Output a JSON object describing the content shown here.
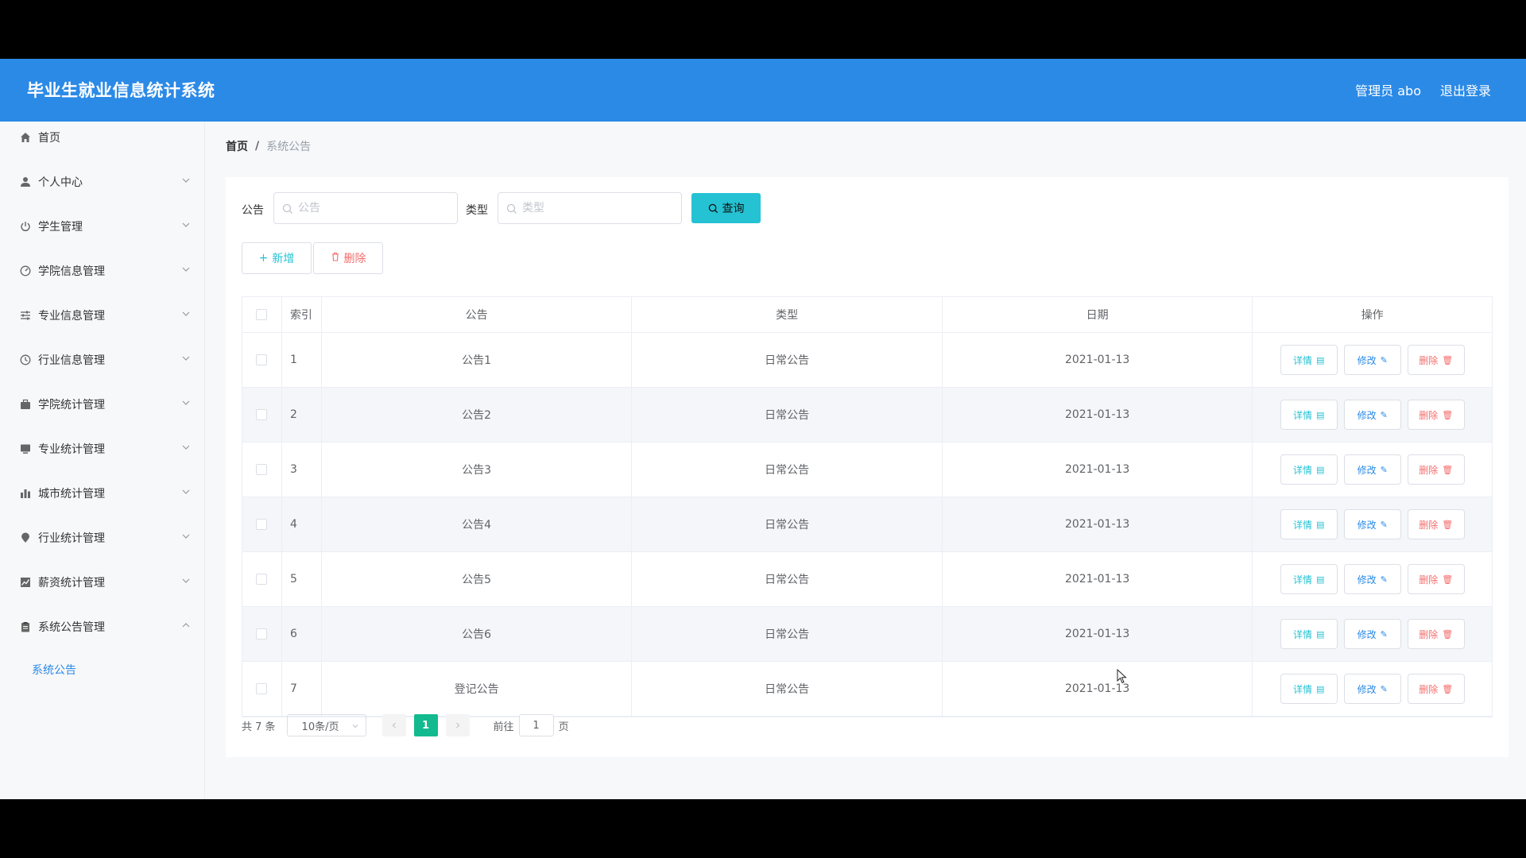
{
  "header": {
    "title": "毕业生就业信息统计系统",
    "user": "管理员 abo",
    "logout": "退出登录"
  },
  "sidebar": {
    "items": [
      {
        "label": "首页",
        "icon": "home-icon",
        "arrow": null
      },
      {
        "label": "个人中心",
        "icon": "user-icon",
        "arrow": "down"
      },
      {
        "label": "学生管理",
        "icon": "power-icon",
        "arrow": "down"
      },
      {
        "label": "学院信息管理",
        "icon": "gauge-icon",
        "arrow": "down"
      },
      {
        "label": "专业信息管理",
        "icon": "sliders-icon",
        "arrow": "down"
      },
      {
        "label": "行业信息管理",
        "icon": "clock-icon",
        "arrow": "down"
      },
      {
        "label": "学院统计管理",
        "icon": "briefcase-icon",
        "arrow": "down"
      },
      {
        "label": "专业统计管理",
        "icon": "monitor-icon",
        "arrow": "down"
      },
      {
        "label": "城市统计管理",
        "icon": "bar-chart-icon",
        "arrow": "down"
      },
      {
        "label": "行业统计管理",
        "icon": "pin-icon",
        "arrow": "down"
      },
      {
        "label": "薪资统计管理",
        "icon": "line-chart-icon",
        "arrow": "down"
      },
      {
        "label": "系统公告管理",
        "icon": "clipboard-icon",
        "arrow": "up"
      }
    ],
    "submenu": {
      "label": "系统公告"
    }
  },
  "breadcrumb": {
    "home": "首页",
    "separator": "/",
    "current": "系统公告"
  },
  "search": {
    "title_label": "公告",
    "title_placeholder": "公告",
    "type_label": "类型",
    "type_placeholder": "类型",
    "query_button": "查询"
  },
  "actions": {
    "add": "新增",
    "delete": "删除"
  },
  "table": {
    "headers": {
      "index": "索引",
      "title": "公告",
      "type": "类型",
      "date": "日期",
      "ops": "操作"
    },
    "op_labels": {
      "detail": "详情",
      "edit": "修改",
      "delete": "删除"
    },
    "rows": [
      {
        "index": "1",
        "title": "公告1",
        "type": "日常公告",
        "date": "2021-01-13"
      },
      {
        "index": "2",
        "title": "公告2",
        "type": "日常公告",
        "date": "2021-01-13"
      },
      {
        "index": "3",
        "title": "公告3",
        "type": "日常公告",
        "date": "2021-01-13"
      },
      {
        "index": "4",
        "title": "公告4",
        "type": "日常公告",
        "date": "2021-01-13"
      },
      {
        "index": "5",
        "title": "公告5",
        "type": "日常公告",
        "date": "2021-01-13"
      },
      {
        "index": "6",
        "title": "公告6",
        "type": "日常公告",
        "date": "2021-01-13"
      },
      {
        "index": "7",
        "title": "登记公告",
        "type": "日常公告",
        "date": "2021-01-13"
      }
    ]
  },
  "pagination": {
    "total": "共 7 条",
    "page_size": "10条/页",
    "current_page": "1",
    "goto_label": "前往",
    "goto_value": "1",
    "page_suffix": "页"
  },
  "colors": {
    "header_bg": "#2b8ae6",
    "accent_teal": "#25c2d3",
    "danger": "#f56c6c",
    "page_active": "#13ba8f"
  }
}
